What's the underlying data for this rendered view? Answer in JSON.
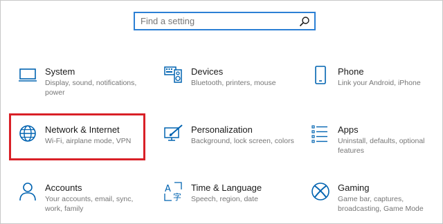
{
  "search": {
    "placeholder": "Find a setting"
  },
  "tiles": [
    {
      "title": "System",
      "desc_lines": [
        "Display, sound, notifications,",
        "power"
      ]
    },
    {
      "title": "Devices",
      "desc_lines": [
        "Bluetooth, printers, mouse"
      ]
    },
    {
      "title": "Phone",
      "desc_lines": [
        "Link your Android, iPhone"
      ]
    },
    {
      "title": "Network & Internet",
      "desc_lines": [
        "Wi-Fi, airplane mode, VPN"
      ]
    },
    {
      "title": "Personalization",
      "desc_lines": [
        "Background, lock screen, colors"
      ]
    },
    {
      "title": "Apps",
      "desc_lines": [
        "Uninstall, defaults, optional",
        "features"
      ]
    },
    {
      "title": "Accounts",
      "desc_lines": [
        "Your accounts, email, sync,",
        "work, family"
      ]
    },
    {
      "title": "Time & Language",
      "desc_lines": [
        "Speech, region, date"
      ]
    },
    {
      "title": "Gaming",
      "desc_lines": [
        "Game bar, captures,",
        "broadcasting, Game Mode"
      ]
    }
  ],
  "colors": {
    "accent": "#0063b1",
    "highlight": "#d92027"
  },
  "icons": [
    "monitor-icon",
    "devices-icon",
    "phone-icon",
    "globe-icon",
    "personalization-icon",
    "apps-icon",
    "accounts-icon",
    "time-language-icon",
    "xbox-icon"
  ]
}
